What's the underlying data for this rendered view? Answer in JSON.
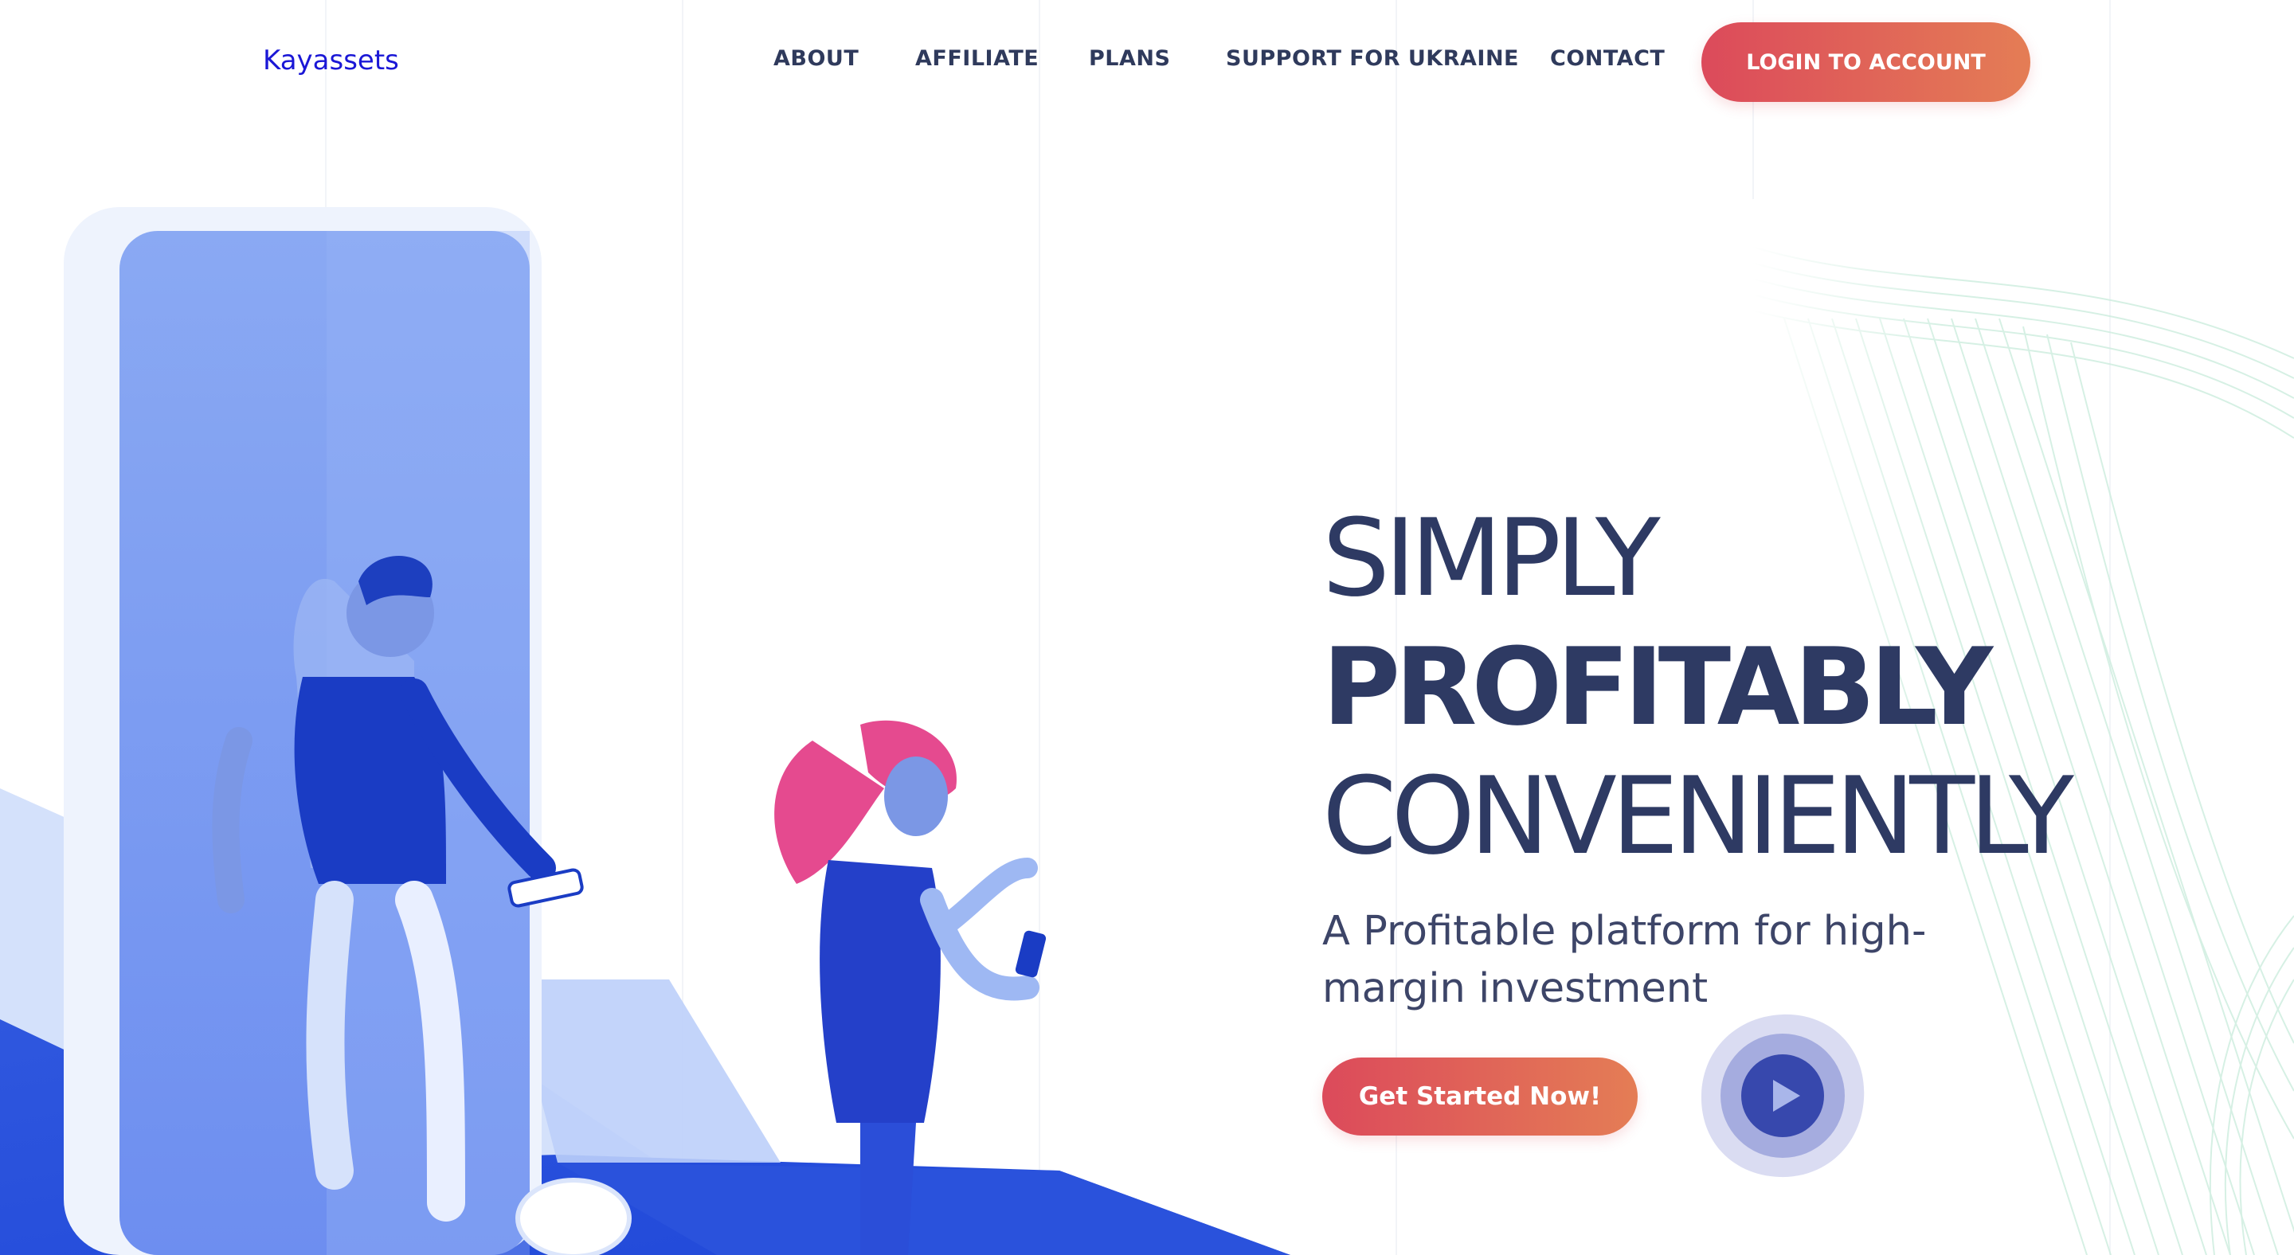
{
  "header": {
    "logo": "Kayassets",
    "nav_items": [
      {
        "label": "ABOUT"
      },
      {
        "label": "AFFILIATE"
      },
      {
        "label": "PLANS"
      },
      {
        "label": "SUPPORT FOR UKRAINE"
      },
      {
        "label": "CONTACT"
      }
    ],
    "login_label": "LOGIN TO ACCOUNT"
  },
  "hero": {
    "line1": "SIMPLY",
    "line2": "PROFITABLY",
    "line3": "CONVENIENTLY",
    "subtitle": "A Profitable platform for high-margin investment",
    "cta_label": "Get Started Now!",
    "play_icon": "play-icon"
  },
  "colors": {
    "brand_blue": "#1a17d6",
    "heading": "#2e3a63",
    "button_gradient_start": "#dc4a5b",
    "button_gradient_end": "#e47d55",
    "play_outer": "#dadcf2",
    "play_mid": "#a5acdf",
    "play_inner": "#3748ad"
  }
}
